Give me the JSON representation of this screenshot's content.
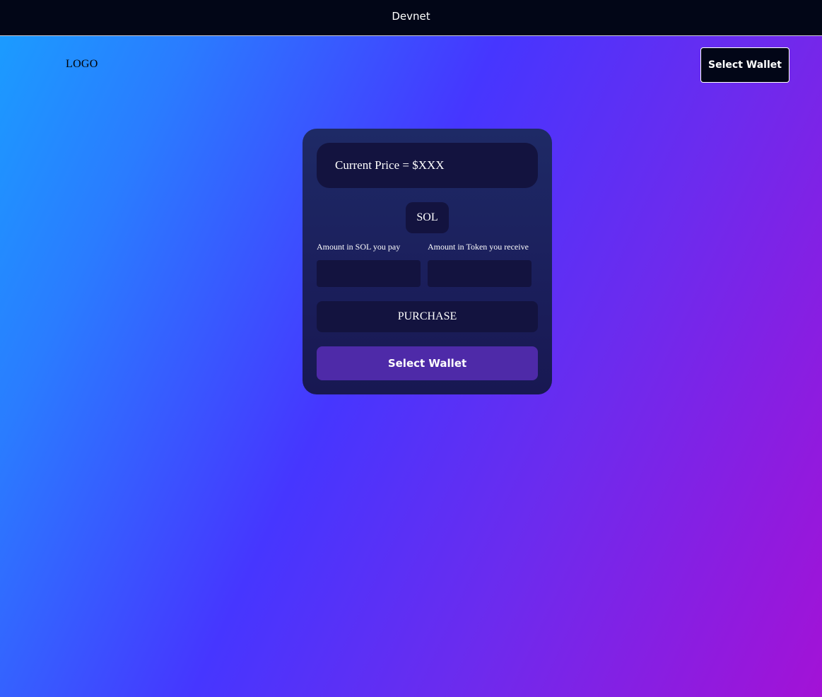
{
  "topbar": {
    "network_label": "Devnet"
  },
  "header": {
    "logo_text": "LOGO",
    "wallet_button_label": "Select Wallet"
  },
  "card": {
    "price_text": "Current Price = $XXX",
    "currency_badge": "SOL",
    "pay_label": "Amount in SOL you pay",
    "receive_label": "Amount in Token you receive",
    "pay_value": "",
    "receive_value": "",
    "purchase_label": "PURCHASE",
    "wallet_button_label": "Select Wallet"
  },
  "colors": {
    "background_start": "#1a9eff",
    "background_mid": "#4636ff",
    "background_end": "#a312d6",
    "topbar": "#020617",
    "card": "#1b1f5c",
    "field": "#13133f",
    "accent_button": "#4e2aa8"
  }
}
